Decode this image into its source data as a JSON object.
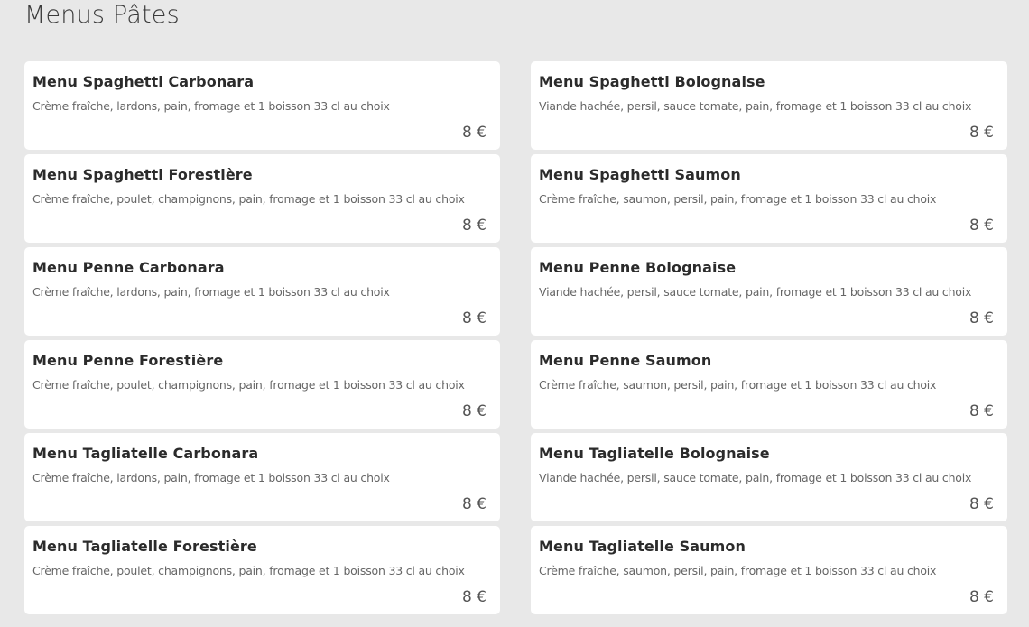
{
  "page": {
    "title": "Menus Pâtes"
  },
  "menus": [
    {
      "name": "Menu Spaghetti Carbonara",
      "description": "Crème fraîche, lardons, pain, fromage et 1 boisson 33 cl au choix",
      "price": "8 €"
    },
    {
      "name": "Menu Spaghetti Bolognaise",
      "description": "Viande hachée, persil, sauce tomate, pain, fromage et 1 boisson 33 cl au choix",
      "price": "8 €"
    },
    {
      "name": "Menu Spaghetti Forestière",
      "description": "Crème fraîche, poulet, champignons, pain, fromage et 1 boisson 33 cl au choix",
      "price": "8 €"
    },
    {
      "name": "Menu Spaghetti Saumon",
      "description": "Crème fraîche, saumon, persil, pain, fromage et 1 boisson 33 cl au choix",
      "price": "8 €"
    },
    {
      "name": "Menu Penne Carbonara",
      "description": "Crème fraîche, lardons, pain, fromage et 1 boisson 33 cl au choix",
      "price": "8 €"
    },
    {
      "name": "Menu Penne Bolognaise",
      "description": "Viande hachée, persil, sauce tomate, pain, fromage et 1 boisson 33 cl au choix",
      "price": "8 €"
    },
    {
      "name": "Menu Penne Forestière",
      "description": "Crème fraîche, poulet, champignons, pain, fromage et 1 boisson 33 cl au choix",
      "price": "8 €"
    },
    {
      "name": "Menu Penne Saumon",
      "description": "Crème fraîche, saumon, persil, pain, fromage et 1 boisson 33 cl au choix",
      "price": "8 €"
    },
    {
      "name": "Menu Tagliatelle Carbonara",
      "description": "Crème fraîche, lardons, pain, fromage et 1 boisson 33 cl au choix",
      "price": "8 €"
    },
    {
      "name": "Menu Tagliatelle Bolognaise",
      "description": "Viande hachée, persil, sauce tomate, pain, fromage et 1 boisson 33 cl au choix",
      "price": "8 €"
    },
    {
      "name": "Menu Tagliatelle Forestière",
      "description": "Crème fraîche, poulet, champignons, pain, fromage et 1 boisson 33 cl au choix",
      "price": "8 €"
    },
    {
      "name": "Menu Tagliatelle Saumon",
      "description": "Crème fraîche, saumon, persil, pain, fromage et 1 boisson 33 cl au choix",
      "price": "8 €"
    }
  ]
}
